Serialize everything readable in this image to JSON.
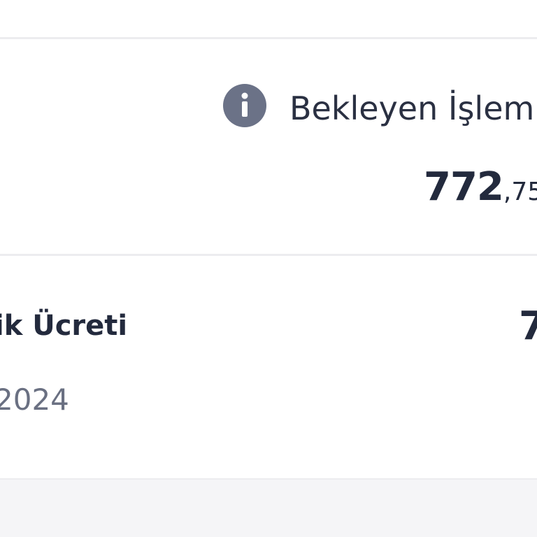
{
  "pending": {
    "icon": "info-icon",
    "label": "Bekleyen İşlem",
    "amount_int": "772",
    "amount_frac": ",75"
  },
  "transaction": {
    "title": "ik Ücreti",
    "date": "2024",
    "amount_partial": "7"
  },
  "colors": {
    "text_primary": "#232a3d",
    "text_secondary": "#6a7082",
    "icon_bg": "#6b7287",
    "divider": "#ececef",
    "bottom_bg": "#f5f5f7"
  }
}
